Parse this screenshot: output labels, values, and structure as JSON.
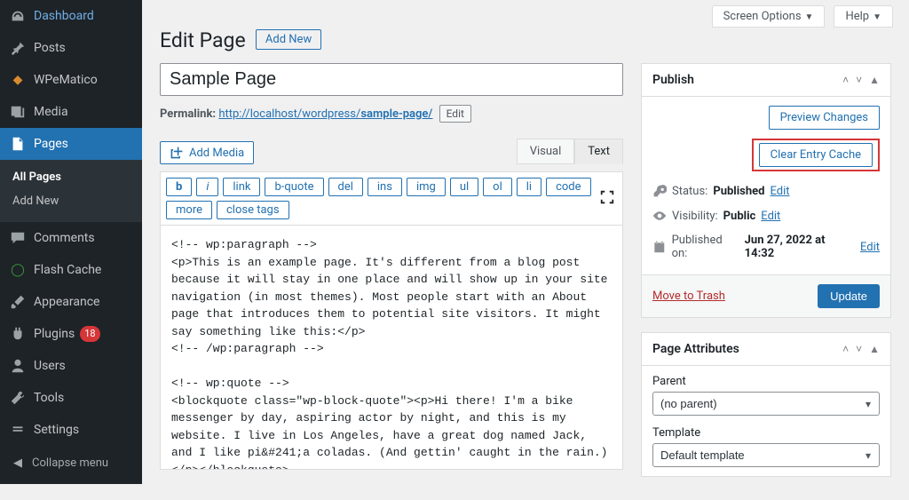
{
  "top": {
    "screen_options": "Screen Options",
    "help": "Help"
  },
  "sidebar": {
    "items": [
      {
        "label": "Dashboard"
      },
      {
        "label": "Posts"
      },
      {
        "label": "WPeMatico"
      },
      {
        "label": "Media"
      },
      {
        "label": "Pages"
      },
      {
        "label": "Comments"
      },
      {
        "label": "Flash Cache"
      },
      {
        "label": "Appearance"
      },
      {
        "label": "Plugins",
        "badge": "18"
      },
      {
        "label": "Users"
      },
      {
        "label": "Tools"
      },
      {
        "label": "Settings"
      }
    ],
    "pages_submenu": {
      "all_pages": "All Pages",
      "add_new": "Add New"
    },
    "collapse": "Collapse menu"
  },
  "page": {
    "heading": "Edit Page",
    "add_new": "Add New",
    "title_value": "Sample Page",
    "permalink_label": "Permalink:",
    "permalink_base": "http://localhost/wordpress/",
    "permalink_slug": "sample-page/",
    "permalink_edit": "Edit"
  },
  "editor": {
    "add_media": "Add Media",
    "tabs": {
      "visual": "Visual",
      "text": "Text"
    },
    "quicktags": [
      "b",
      "i",
      "link",
      "b-quote",
      "del",
      "ins",
      "img",
      "ul",
      "ol",
      "li",
      "code",
      "more",
      "close tags"
    ],
    "content": "<!-- wp:paragraph -->\n<p>This is an example page. It's different from a blog post because it will stay in one place and will show up in your site navigation (in most themes). Most people start with an About page that introduces them to potential site visitors. It might say something like this:</p>\n<!-- /wp:paragraph -->\n\n<!-- wp:quote -->\n<blockquote class=\"wp-block-quote\"><p>Hi there! I'm a bike messenger by day, aspiring actor by night, and this is my website. I live in Los Angeles, have a great dog named Jack, and I like pi&#241;a coladas. (And gettin' caught in the rain.)</p></blockquote>\n<!-- /wp:quote -->\n\n<!-- wp:paragraph -->"
  },
  "publish": {
    "title": "Publish",
    "preview": "Preview Changes",
    "clear_cache": "Clear Entry Cache",
    "status_label": "Status:",
    "status_value": "Published",
    "edit": "Edit",
    "visibility_label": "Visibility:",
    "visibility_value": "Public",
    "published_label": "Published on:",
    "published_value": "Jun 27, 2022 at 14:32",
    "trash": "Move to Trash",
    "update": "Update"
  },
  "page_attributes": {
    "title": "Page Attributes",
    "parent_label": "Parent",
    "parent_value": "(no parent)",
    "template_label": "Template",
    "template_value": "Default template"
  }
}
